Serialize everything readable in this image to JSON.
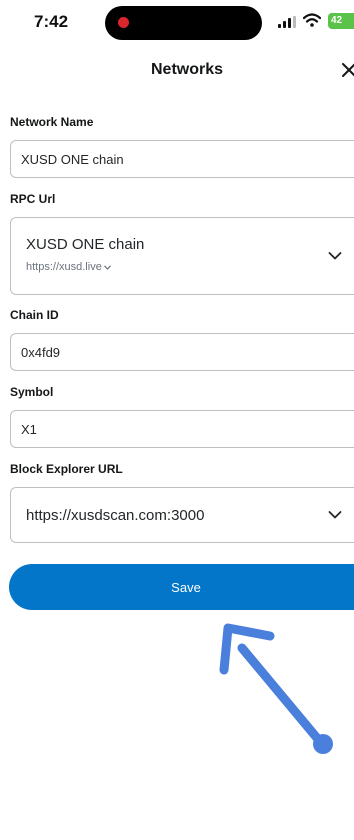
{
  "status_bar": {
    "time": "7:42",
    "battery": "42",
    "battery_color": "#5bc24a"
  },
  "header": {
    "title": "Networks",
    "close_icon": "close-icon"
  },
  "form": {
    "network_name": {
      "label": "Network Name",
      "value": "XUSD ONE chain"
    },
    "rpc_url": {
      "label": "RPC Url",
      "selected_name": "XUSD ONE chain",
      "selected_url": "https://xusd.live"
    },
    "chain_id": {
      "label": "Chain ID",
      "value": "0x4fd9"
    },
    "symbol": {
      "label": "Symbol",
      "value": "X1"
    },
    "block_explorer": {
      "label": "Block Explorer URL",
      "value": "https://xusdscan.com:3000"
    }
  },
  "save_label": "Save",
  "colors": {
    "primary": "#0376c9",
    "annotation_arrow": "#4a7fdc",
    "border": "#bbc0c5"
  }
}
